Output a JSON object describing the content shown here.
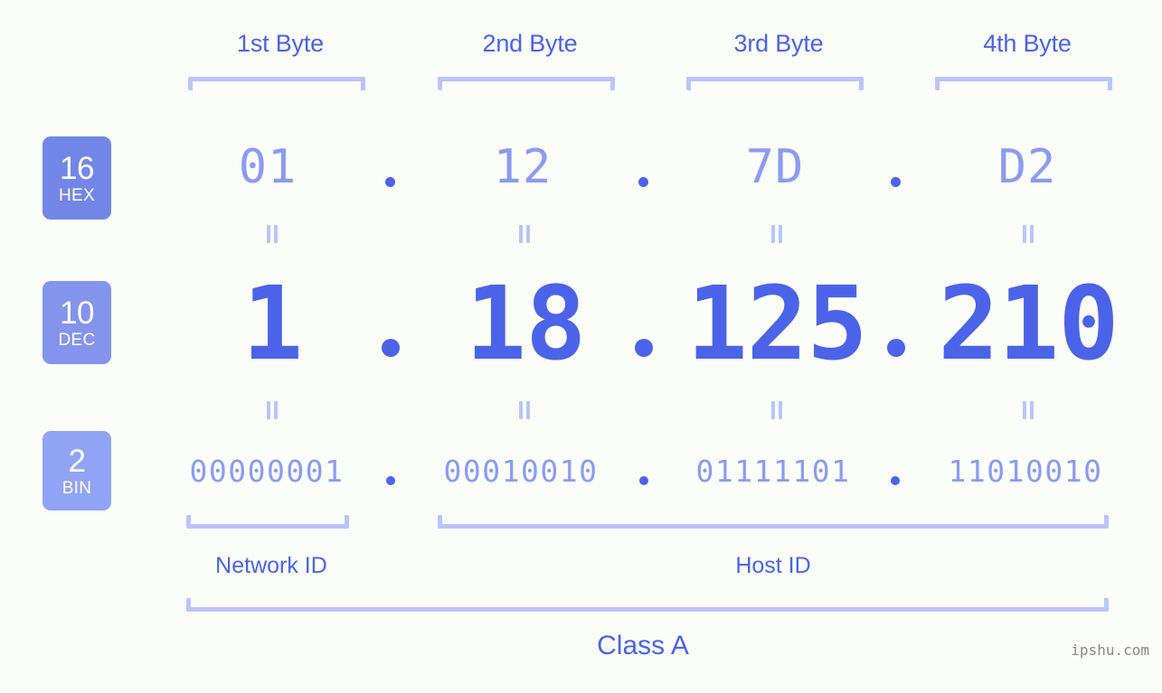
{
  "theme": {
    "background": "#fbfdf9",
    "accent_strong": "#4b63e8",
    "accent_light": "#8b9bf2",
    "bracket": "#b9c4fb",
    "badge_hex_bg": "#7286e8",
    "badge_dec_bg": "#8494ec",
    "badge_bin_bg": "#91a3f5",
    "watermark_color": "#8a8a8a"
  },
  "header": {
    "byte_labels": [
      "1st Byte",
      "2nd Byte",
      "3rd Byte",
      "4th Byte"
    ]
  },
  "bases": [
    {
      "number": "16",
      "name": "HEX"
    },
    {
      "number": "10",
      "name": "DEC"
    },
    {
      "number": "2",
      "name": "BIN"
    }
  ],
  "separator": ".",
  "rows": {
    "hex": {
      "base_number": "16",
      "base_name": "HEX",
      "octets": [
        "01",
        "12",
        "7D",
        "D2"
      ],
      "address": "01.12.7D.D2"
    },
    "dec": {
      "base_number": "10",
      "base_name": "DEC",
      "octets": [
        "1",
        "18",
        "125",
        "210"
      ],
      "address": "1.18.125.210"
    },
    "bin": {
      "base_number": "2",
      "base_name": "BIN",
      "octets": [
        "00000001",
        "00010010",
        "01111101",
        "11010010"
      ],
      "address": "00000001.00010010.01111101.11010010"
    }
  },
  "equality_symbol": "=",
  "footer": {
    "network_id_label": "Network ID",
    "host_id_label": "Host ID",
    "class_label": "Class A"
  },
  "watermark": "ipshu.com"
}
